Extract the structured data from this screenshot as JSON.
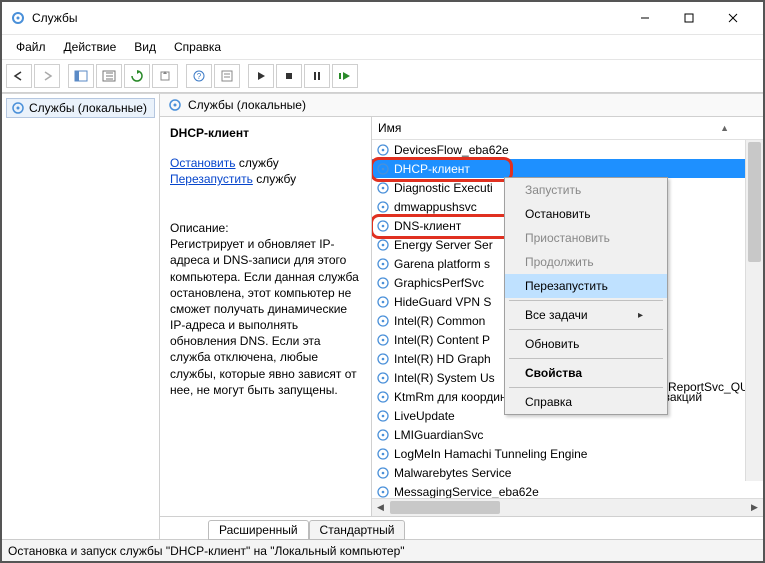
{
  "window": {
    "title": "Службы"
  },
  "menu": {
    "file": "Файл",
    "action": "Действие",
    "view": "Вид",
    "help": "Справка"
  },
  "nav": {
    "node": "Службы (локальные)"
  },
  "content_header": "Службы (локальные)",
  "detail": {
    "service_name": "DHCP-клиент",
    "stop_link": "Остановить",
    "stop_suffix": " службу",
    "restart_link": "Перезапустить",
    "restart_suffix": " службу",
    "desc_label": "Описание:",
    "desc_text": "Регистрирует и обновляет IP-адреса и DNS-записи для этого компьютера. Если данная служба остановлена, этот компьютер не сможет получать динамические IP-адреса и выполнять обновления DNS. Если эта служба отключена, любые службы, которые явно зависят от нее, не могут быть запущены."
  },
  "list": {
    "header": "Имя",
    "items": [
      "DevicesFlow_eba62e",
      "DHCP-клиент",
      "Diagnostic Executi",
      "dmwappushsvc",
      "DNS-клиент",
      "Energy Server Ser",
      "Garena platform s",
      "GraphicsPerfSvc",
      "HideGuard VPN S",
      "Intel(R) Common",
      "Intel(R) Content P",
      "Intel(R) HD Graph",
      "Intel(R) System Us",
      "KtmRm для координатора распределенных транзакций",
      "LiveUpdate",
      "LMIGuardianSvc",
      "LogMeIn Hamachi Tunneling Engine",
      "Malwarebytes Service",
      "MessagingService_eba62e"
    ],
    "truncated_overlay": "ReportSvc_QU...",
    "selected_index": 1
  },
  "context_menu": {
    "items": [
      {
        "label": "Запустить",
        "enabled": false
      },
      {
        "label": "Остановить",
        "enabled": true
      },
      {
        "label": "Приостановить",
        "enabled": false
      },
      {
        "label": "Продолжить",
        "enabled": false
      },
      {
        "label": "Перезапустить",
        "enabled": true,
        "hovered": true
      },
      {
        "sep": true
      },
      {
        "label": "Все задачи",
        "enabled": true,
        "submenu": true
      },
      {
        "sep": true
      },
      {
        "label": "Обновить",
        "enabled": true
      },
      {
        "sep": true
      },
      {
        "label": "Свойства",
        "enabled": true,
        "bold": true
      },
      {
        "sep": true
      },
      {
        "label": "Справка",
        "enabled": true
      }
    ]
  },
  "tabs": {
    "extended": "Расширенный",
    "standard": "Стандартный"
  },
  "statusbar": "Остановка и запуск службы \"DHCP-клиент\" на \"Локальный компьютер\""
}
